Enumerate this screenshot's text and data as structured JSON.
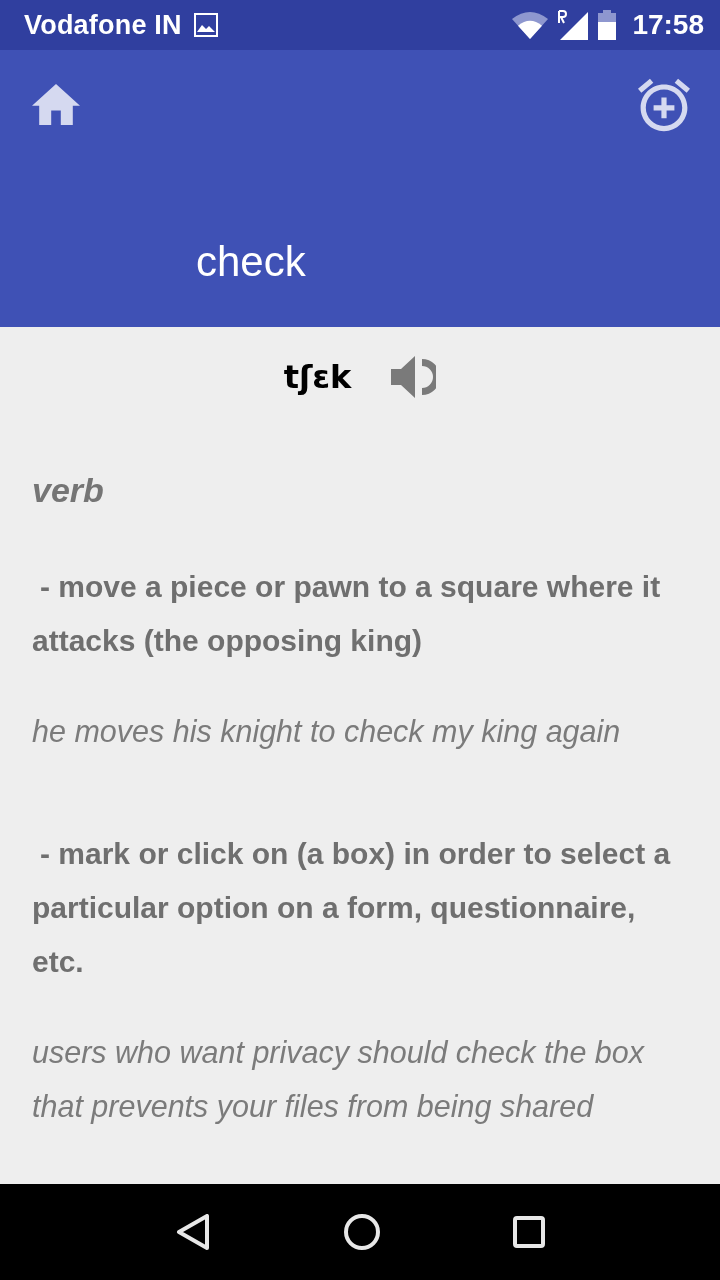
{
  "status_bar": {
    "carrier": "Vodafone IN",
    "time": "17:58"
  },
  "app_bar": {
    "title": "check"
  },
  "pronunciation": {
    "text": "tʃɛk"
  },
  "part_of_speech": "verb",
  "senses": [
    {
      "definition": "- move a piece or pawn to a square where it attacks (the opposing king)",
      "example": "he moves his knight to check my king again"
    },
    {
      "definition": "- mark or click on (a box) in order to select a particular option on a form, questionnaire, etc.",
      "example": "users who want privacy should check the box that prevents your files from being shared"
    }
  ]
}
